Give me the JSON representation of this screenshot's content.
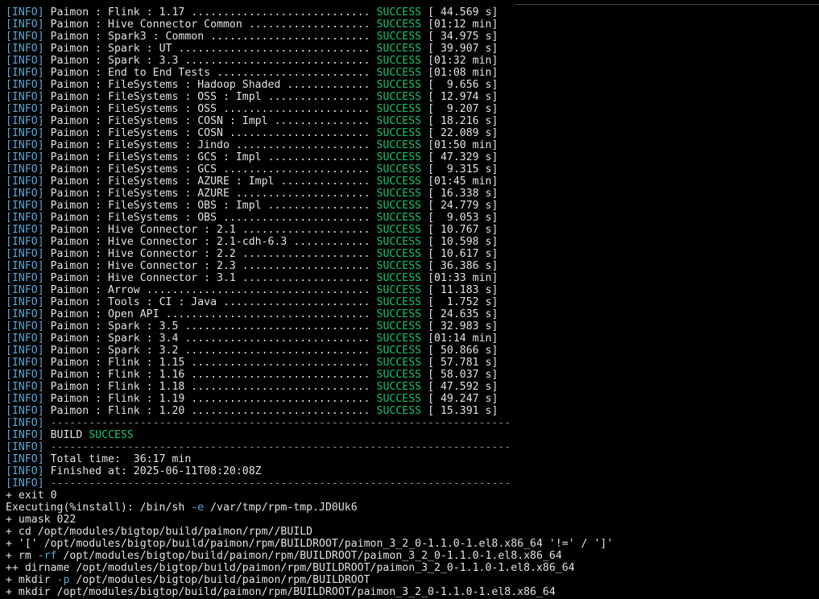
{
  "colors": {
    "background": "#000000",
    "text": "#e2e2e2",
    "info_level": "#5aa9d6",
    "success": "#19c26b",
    "option_flag": "#5aa9d6"
  },
  "modules": [
    {
      "name": "Paimon : Flink : 1.17 ",
      "dots": "............................",
      "status": "SUCCESS",
      "time": "[ 44.569 s]"
    },
    {
      "name": "Paimon : Hive Connector Common ",
      "dots": "...................",
      "status": "SUCCESS",
      "time": "[01:12 min]"
    },
    {
      "name": "Paimon : Spark3 : Common ",
      "dots": ".........................",
      "status": "SUCCESS",
      "time": "[ 34.975 s]"
    },
    {
      "name": "Paimon : Spark : UT ",
      "dots": "..............................",
      "status": "SUCCESS",
      "time": "[ 39.907 s]"
    },
    {
      "name": "Paimon : Spark : 3.3 ",
      "dots": ".............................",
      "status": "SUCCESS",
      "time": "[01:32 min]"
    },
    {
      "name": "Paimon : End to End Tests ",
      "dots": "........................",
      "status": "SUCCESS",
      "time": "[01:08 min]"
    },
    {
      "name": "Paimon : FileSystems : Hadoop Shaded ",
      "dots": ".............",
      "status": "SUCCESS",
      "time": "[  9.656 s]"
    },
    {
      "name": "Paimon : FileSystems : OSS : Impl ",
      "dots": "................",
      "status": "SUCCESS",
      "time": "[ 12.974 s]"
    },
    {
      "name": "Paimon : FileSystems : OSS ",
      "dots": ".......................",
      "status": "SUCCESS",
      "time": "[  9.207 s]"
    },
    {
      "name": "Paimon : FileSystems : COSN : Impl ",
      "dots": "...............",
      "status": "SUCCESS",
      "time": "[ 18.216 s]"
    },
    {
      "name": "Paimon : FileSystems : COSN ",
      "dots": "......................",
      "status": "SUCCESS",
      "time": "[ 22.089 s]"
    },
    {
      "name": "Paimon : FileSystems : Jindo ",
      "dots": ".....................",
      "status": "SUCCESS",
      "time": "[01:50 min]"
    },
    {
      "name": "Paimon : FileSystems : GCS : Impl ",
      "dots": "................",
      "status": "SUCCESS",
      "time": "[ 47.329 s]"
    },
    {
      "name": "Paimon : FileSystems : GCS ",
      "dots": ".......................",
      "status": "SUCCESS",
      "time": "[  9.315 s]"
    },
    {
      "name": "Paimon : FileSystems : AZURE : Impl ",
      "dots": "..............",
      "status": "SUCCESS",
      "time": "[01:45 min]"
    },
    {
      "name": "Paimon : FileSystems : AZURE ",
      "dots": ".....................",
      "status": "SUCCESS",
      "time": "[ 16.338 s]"
    },
    {
      "name": "Paimon : FileSystems : OBS : Impl ",
      "dots": "................",
      "status": "SUCCESS",
      "time": "[ 24.779 s]"
    },
    {
      "name": "Paimon : FileSystems : OBS ",
      "dots": ".......................",
      "status": "SUCCESS",
      "time": "[  9.053 s]"
    },
    {
      "name": "Paimon : Hive Connector : 2.1 ",
      "dots": "....................",
      "status": "SUCCESS",
      "time": "[ 10.767 s]"
    },
    {
      "name": "Paimon : Hive Connector : 2.1-cdh-6.3 ",
      "dots": "............",
      "status": "SUCCESS",
      "time": "[ 10.598 s]"
    },
    {
      "name": "Paimon : Hive Connector : 2.2 ",
      "dots": "....................",
      "status": "SUCCESS",
      "time": "[ 10.617 s]"
    },
    {
      "name": "Paimon : Hive Connector : 2.3 ",
      "dots": "....................",
      "status": "SUCCESS",
      "time": "[ 36.386 s]"
    },
    {
      "name": "Paimon : Hive Connector : 3.1 ",
      "dots": "....................",
      "status": "SUCCESS",
      "time": "[01:33 min]"
    },
    {
      "name": "Paimon : Arrow ",
      "dots": "...................................",
      "status": "SUCCESS",
      "time": "[ 11.183 s]"
    },
    {
      "name": "Paimon : Tools : CI : Java ",
      "dots": ".......................",
      "status": "SUCCESS",
      "time": "[  1.752 s]"
    },
    {
      "name": "Paimon : Open API ",
      "dots": "................................",
      "status": "SUCCESS",
      "time": "[ 24.635 s]"
    },
    {
      "name": "Paimon : Spark : 3.5 ",
      "dots": ".............................",
      "status": "SUCCESS",
      "time": "[ 32.983 s]"
    },
    {
      "name": "Paimon : Spark : 3.4 ",
      "dots": ".............................",
      "status": "SUCCESS",
      "time": "[01:14 min]"
    },
    {
      "name": "Paimon : Spark : 3.2 ",
      "dots": ".............................",
      "status": "SUCCESS",
      "time": "[ 50.866 s]"
    },
    {
      "name": "Paimon : Flink : 1.15 ",
      "dots": "............................",
      "status": "SUCCESS",
      "time": "[ 57.781 s]"
    },
    {
      "name": "Paimon : Flink : 1.16 ",
      "dots": "............................",
      "status": "SUCCESS",
      "time": "[ 58.037 s]"
    },
    {
      "name": "Paimon : Flink : 1.18 ",
      "dots": "............................",
      "status": "SUCCESS",
      "time": "[ 47.592 s]"
    },
    {
      "name": "Paimon : Flink : 1.19 ",
      "dots": "............................",
      "status": "SUCCESS",
      "time": "[ 49.247 s]"
    },
    {
      "name": "Paimon : Flink : 1.20 ",
      "dots": "............................",
      "status": "SUCCESS",
      "time": "[ 15.391 s]"
    }
  ],
  "summary": {
    "level": "[INFO]",
    "separator": "------------------------------------------------------------------------",
    "build_prefix": "BUILD ",
    "build_status": "SUCCESS",
    "total_time": "Total time:  36:17 min",
    "finished_at": "Finished at: 2025-06-11T08:20:08Z"
  },
  "shell": [
    {
      "text": "+ exit 0"
    },
    {
      "pre": "Executing(%install): /bin/sh ",
      "opt": "-e",
      "post": " /var/tmp/rpm-tmp.JD0Uk6"
    },
    {
      "text": "+ umask 022"
    },
    {
      "text": "+ cd /opt/modules/bigtop/build/paimon/rpm//BUILD"
    },
    {
      "text": "+ '[' /opt/modules/bigtop/build/paimon/rpm/BUILDROOT/paimon_3_2_0-1.1.0-1.el8.x86_64 '!=' / ']'"
    },
    {
      "pre": "+ rm ",
      "opt": "-rf",
      "post": " /opt/modules/bigtop/build/paimon/rpm/BUILDROOT/paimon_3_2_0-1.1.0-1.el8.x86_64"
    },
    {
      "text": "++ dirname /opt/modules/bigtop/build/paimon/rpm/BUILDROOT/paimon_3_2_0-1.1.0-1.el8.x86_64"
    },
    {
      "pre": "+ mkdir ",
      "opt": "-p",
      "post": " /opt/modules/bigtop/build/paimon/rpm/BUILDROOT"
    },
    {
      "text": "+ mkdir /opt/modules/bigtop/build/paimon/rpm/BUILDROOT/paimon_3_2_0-1.1.0-1.el8.x86_64"
    }
  ]
}
